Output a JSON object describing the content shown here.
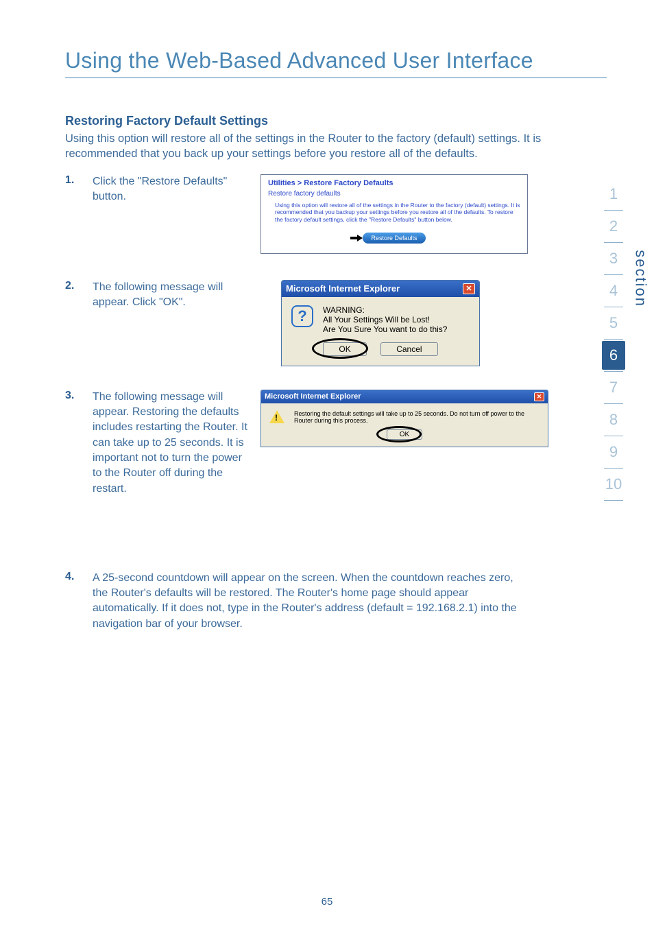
{
  "page": {
    "title": "Using the Web-Based Advanced User Interface",
    "number": "65"
  },
  "section_label": "section",
  "heading": "Restoring Factory Default Settings",
  "intro": "Using this option will restore all of the settings in the Router to the factory (default) settings. It is recommended that you back up your settings before you restore all of the defaults.",
  "steps": {
    "s1": {
      "num": "1.",
      "text": "Click the \"Restore Defaults\" button."
    },
    "s2": {
      "num": "2.",
      "text": "The following message will appear. Click \"OK\"."
    },
    "s3": {
      "num": "3.",
      "text": "The following message will appear. Restoring the defaults includes restarting the Router. It can take up to 25 seconds. It is important not to turn the power to the Router off during the restart."
    },
    "s4": {
      "num": "4.",
      "text": "A 25-second countdown will appear on the screen. When the countdown reaches zero, the Router's defaults will be restored. The Router's home page should appear automatically. If it does not, type in the Router's address (default = 192.168.2.1) into the navigation bar of your browser."
    }
  },
  "fig1": {
    "breadcrumb": "Utilities > Restore Factory Defaults",
    "sub": "Restore factory defaults",
    "desc": "Using this option will restore all of the settings in the Router to the factory (default) settings. It is recommended that you backup your settings before you restore all of the defaults. To restore the factory default settings, click the \"Restore Defaults\" button below.",
    "button": "Restore Defaults"
  },
  "fig2": {
    "title": "Microsoft Internet Explorer",
    "close": "✕",
    "warn_head": "WARNING:",
    "warn_l1": "All Your Settings Will be Lost!",
    "warn_l2": "Are You Sure You want to do this?",
    "ok": "OK",
    "cancel": "Cancel"
  },
  "fig3": {
    "title": "Microsoft Internet Explorer",
    "close": "✕",
    "msg": "Restoring the default settings will take up to 25 seconds. Do not turn off power to the Router during this process.",
    "ok": "OK"
  },
  "nav": {
    "n1": "1",
    "n2": "2",
    "n3": "3",
    "n4": "4",
    "n5": "5",
    "n6": "6",
    "n7": "7",
    "n8": "8",
    "n9": "9",
    "n10": "10"
  }
}
